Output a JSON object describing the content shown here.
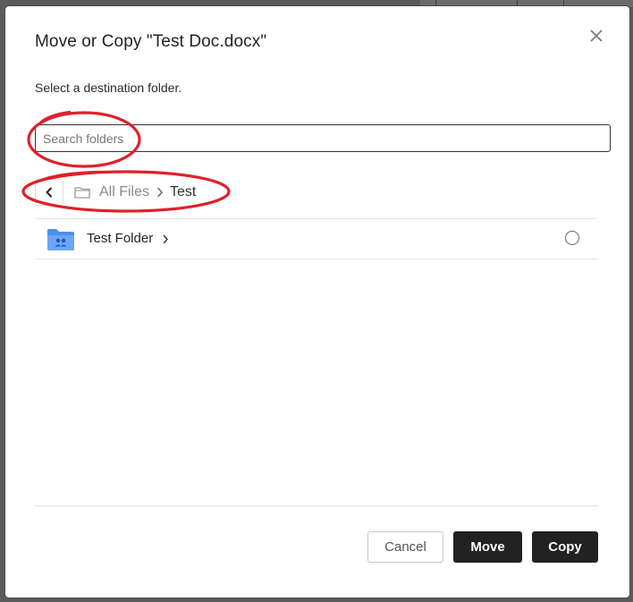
{
  "dialog": {
    "title": "Move or Copy \"Test Doc.docx\"",
    "subtitle": "Select a destination folder.",
    "close_icon": "close-icon"
  },
  "search": {
    "placeholder": "Search folders",
    "value": ""
  },
  "breadcrumb": {
    "back_icon": "chevron-left-icon",
    "folder_icon": "folder-outline-icon",
    "items": [
      "All Files",
      "Test"
    ],
    "separator_icon": "chevron-right-icon"
  },
  "folders": [
    {
      "name": "Test Folder",
      "icon": "shared-folder-icon",
      "chevron_icon": "chevron-right-icon",
      "selected": false
    }
  ],
  "buttons": {
    "cancel": "Cancel",
    "move": "Move",
    "copy": "Copy"
  },
  "colors": {
    "accent_dark": "#222222",
    "folder_blue": "#4a8ef0",
    "annotation_red": "#e0202a"
  }
}
